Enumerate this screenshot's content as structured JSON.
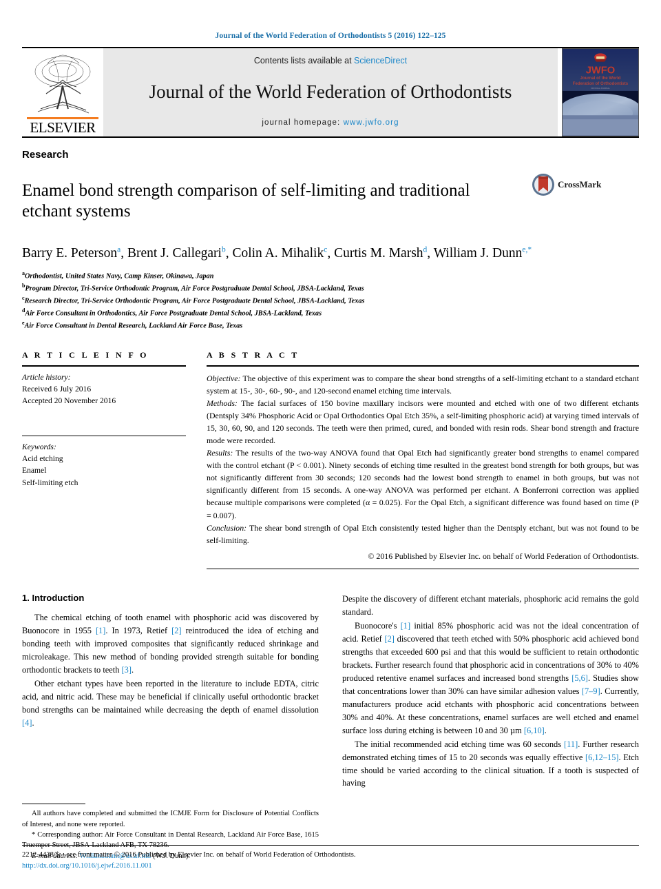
{
  "running_head": "Journal of the World Federation of Orthodontists 5 (2016) 122–125",
  "masthead": {
    "publisher_name": "ELSEVIER",
    "contents_prefix": "Contents lists available at ",
    "contents_link": "ScienceDirect",
    "journal_title": "Journal of the World Federation of Orthodontists",
    "homepage_prefix": "journal homepage: ",
    "homepage_url": "www.jwfo.org",
    "cover": {
      "acronym": "JWFO",
      "line1": "Journal of the World",
      "line2": "Federation of Orthodontists"
    }
  },
  "article": {
    "kind": "Research",
    "title": "Enamel bond strength comparison of self-limiting and traditional etchant systems",
    "crossmark_label": "CrossMark",
    "authors": [
      {
        "name": "Barry E. Peterson",
        "sup": "a",
        "sep": ", "
      },
      {
        "name": "Brent J. Callegari",
        "sup": "b",
        "sep": ", "
      },
      {
        "name": "Colin A. Mihalik",
        "sup": "c",
        "sep": ", "
      },
      {
        "name": "Curtis M. Marsh",
        "sup": "d",
        "sep": ", "
      },
      {
        "name": "William J. Dunn",
        "sup": "e,*",
        "sep": ""
      }
    ],
    "affiliations": [
      {
        "mark": "a",
        "text": "Orthodontist, United States Navy, Camp Kinser, Okinawa, Japan"
      },
      {
        "mark": "b",
        "text": "Program Director, Tri-Service Orthodontic Program, Air Force Postgraduate Dental School, JBSA-Lackland, Texas"
      },
      {
        "mark": "c",
        "text": "Research Director, Tri-Service Orthodontic Program, Air Force Postgraduate Dental School, JBSA-Lackland, Texas"
      },
      {
        "mark": "d",
        "text": "Air Force Consultant in Orthodontics, Air Force Postgraduate Dental School, JBSA-Lackland, Texas"
      },
      {
        "mark": "e",
        "text": "Air Force Consultant in Dental Research, Lackland Air Force Base, Texas"
      }
    ]
  },
  "article_info": {
    "heading": "A R T I C L E  I N F O",
    "history_label": "Article history:",
    "history": [
      "Received 6 July 2016",
      "Accepted 20 November 2016"
    ],
    "keywords_label": "Keywords:",
    "keywords": [
      "Acid etching",
      "Enamel",
      "Self-limiting etch"
    ]
  },
  "abstract": {
    "heading": "A B S T R A C T",
    "objective_label": "Objective:",
    "objective_text": " The objective of this experiment was to compare the shear bond strengths of a self-limiting etchant to a standard etchant system at 15-, 30-, 60-, 90-, and 120-second enamel etching time intervals.",
    "methods_label": "Methods:",
    "methods_text": " The facial surfaces of 150 bovine maxillary incisors were mounted and etched with one of two different etchants (Dentsply 34% Phosphoric Acid or Opal Orthodontics Opal Etch 35%, a self-limiting phosphoric acid) at varying timed intervals of 15, 30, 60, 90, and 120 seconds. The teeth were then primed, cured, and bonded with resin rods. Shear bond strength and fracture mode were recorded.",
    "results_label": "Results:",
    "results_text": " The results of the two-way ANOVA found that Opal Etch had significantly greater bond strengths to enamel compared with the control etchant (P < 0.001). Ninety seconds of etching time resulted in the greatest bond strength for both groups, but was not significantly different from 30 seconds; 120 seconds had the lowest bond strength to enamel in both groups, but was not significantly different from 15 seconds. A one-way ANOVA was performed per etchant. A Bonferroni correction was applied because multiple comparisons were completed (α = 0.025). For the Opal Etch, a significant difference was found based on time (P = 0.007).",
    "conclusion_label": "Conclusion:",
    "conclusion_text": " The shear bond strength of Opal Etch consistently tested higher than the Dentsply etchant, but was not found to be self-limiting.",
    "copyright": "© 2016 Published by Elsevier Inc. on behalf of World Federation of Orthodontists."
  },
  "introduction": {
    "heading": "1. Introduction",
    "left_paragraphs": [
      "The chemical etching of tooth enamel with phosphoric acid was discovered by Buonocore in 1955 [1]. In 1973, Retief [2] reintroduced the idea of etching and bonding teeth with improved composites that significantly reduced shrinkage and microleakage. This new method of bonding provided strength suitable for bonding orthodontic brackets to teeth [3].",
      "Other etchant types have been reported in the literature to include EDTA, citric acid, and nitric acid. These may be beneficial if clinically useful orthodontic bracket bond strengths can be maintained while decreasing the depth of enamel dissolution [4]."
    ],
    "right_paragraphs": [
      "Despite the discovery of different etchant materials, phosphoric acid remains the gold standard.",
      "Buonocore's [1] initial 85% phosphoric acid was not the ideal concentration of acid. Retief [2] discovered that teeth etched with 50% phosphoric acid achieved bond strengths that exceeded 600 psi and that this would be sufficient to retain orthodontic brackets. Further research found that phosphoric acid in concentrations of 30% to 40% produced retentive enamel surfaces and increased bond strengths [5,6]. Studies show that concentrations lower than 30% can have similar adhesion values [7–9]. Currently, manufacturers produce acid etchants with phosphoric acid concentrations between 30% and 40%. At these concentrations, enamel surfaces are well etched and enamel surface loss during etching is between 10 and 30 μm [6,10].",
      "The initial recommended acid etching time was 60 seconds [11]. Further research demonstrated etching times of 15 to 20 seconds was equally effective [6,12–15]. Etch time should be varied according to the clinical situation. If a tooth is suspected of having"
    ]
  },
  "footnotes": {
    "disclosure": "All authors have completed and submitted the ICMJE Form for Disclosure of Potential Conflicts of Interest, and none were reported.",
    "corresponding": "* Corresponding author: Air Force Consultant in Dental Research, Lackland Air Force Base, 1615 Truemper Street, JBSA-Lackland AFB, TX 78236.",
    "email_label": "E-mail address:",
    "email": "William.dunn@us.af.mil",
    "email_suffix": " (W.J. Dunn)."
  },
  "page_footer": {
    "front_matter": "2212-4438/$ – see front matter © 2016 Published by Elsevier Inc. on behalf of World Federation of Orthodontists.",
    "doi": "http://dx.doi.org/10.1016/j.ejwf.2016.11.001"
  },
  "colors": {
    "link": "#1a86c8",
    "runhead": "#1a6fa8",
    "elsevier_orange": "#f47c20",
    "crossmark_red": "#c0392b"
  }
}
